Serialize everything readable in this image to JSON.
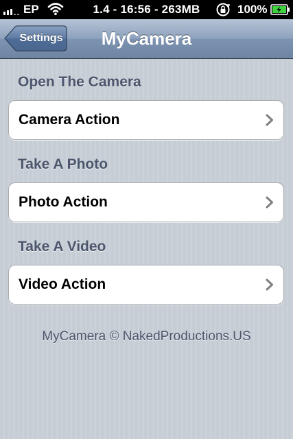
{
  "status_bar": {
    "carrier": "EP",
    "center_text": "1.4 - 16:56 - 263MB",
    "battery_percent": "100%",
    "signal_icon": "signal-bars-icon",
    "wifi_icon": "wifi-icon",
    "lock_icon": "rotation-lock-icon",
    "battery_icon": "battery-charging-icon"
  },
  "nav_bar": {
    "back_label": "Settings",
    "title": "MyCamera"
  },
  "sections": [
    {
      "header": "Open The Camera",
      "cell_label": "Camera Action"
    },
    {
      "header": "Take A Photo",
      "cell_label": "Photo Action"
    },
    {
      "header": "Take A Video",
      "cell_label": "Video Action"
    }
  ],
  "footer": "MyCamera © NakedProductions.US",
  "colors": {
    "nav_bar": "#8da1bd",
    "background": "#c5ccd4",
    "section_header": "#4c566c",
    "battery_green": "#3fd23f"
  }
}
